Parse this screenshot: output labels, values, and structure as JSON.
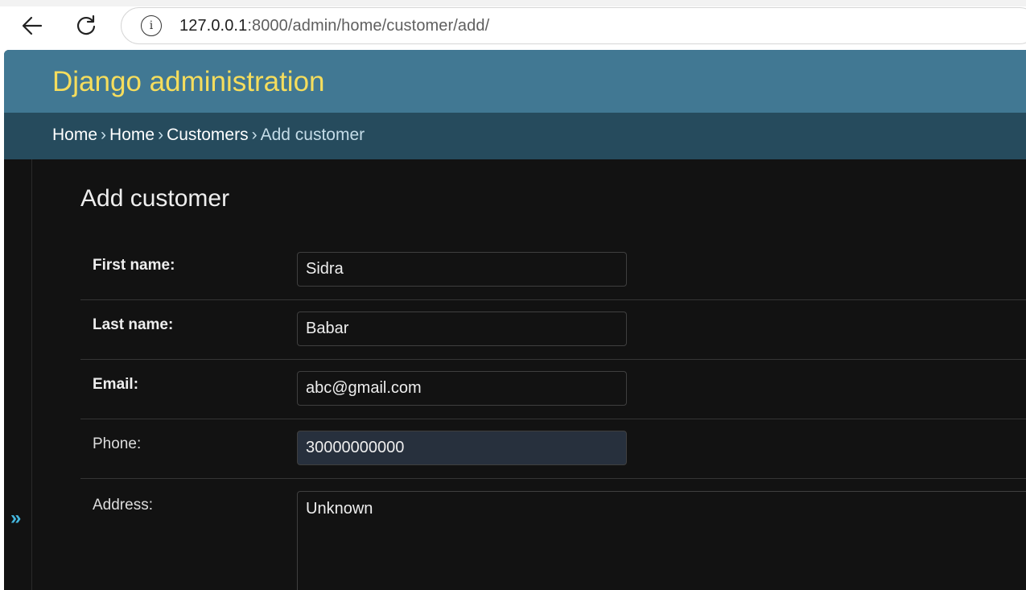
{
  "browser": {
    "url_host": "127.0.0.1",
    "url_rest": ":8000/admin/home/customer/add/"
  },
  "admin": {
    "brand": "Django administration",
    "breadcrumbs": [
      "Home",
      "Home",
      "Customers"
    ],
    "breadcrumb_current": "Add customer",
    "breadcrumb_sep": "›",
    "page_title": "Add customer",
    "sidebar_toggle": "»"
  },
  "form": {
    "first_name": {
      "label": "First name:",
      "value": "Sidra"
    },
    "last_name": {
      "label": "Last name:",
      "value": "Babar"
    },
    "email": {
      "label": "Email:",
      "value": "abc@gmail.com"
    },
    "phone": {
      "label": "Phone:",
      "value": "30000000000"
    },
    "address": {
      "label": "Address:",
      "value": "Unknown"
    }
  },
  "colors": {
    "header_bg": "#417893",
    "breadcrumb_bg": "#264b5d",
    "brand_text": "#f5dd5d",
    "body_bg": "#121212",
    "autofill_bg": "#27303d"
  }
}
